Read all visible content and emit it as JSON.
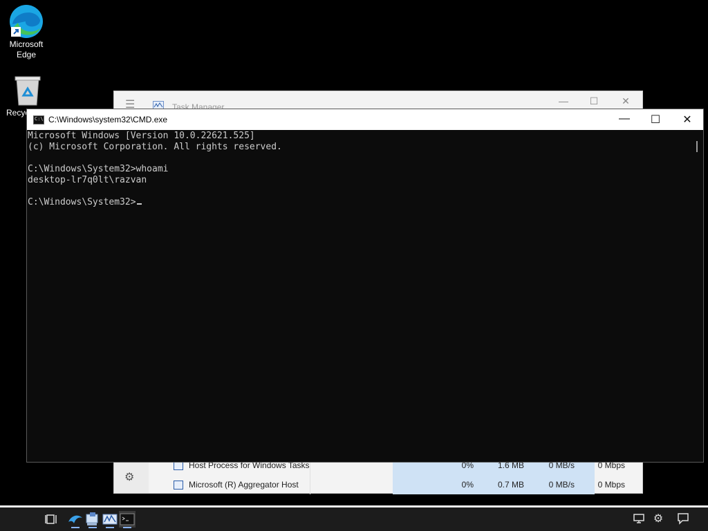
{
  "desktop": {
    "edge_label_line1": "Microsoft",
    "edge_label_line2": "Edge",
    "recycle_label": "Recycle Bin"
  },
  "task_manager": {
    "title": "Task Manager",
    "rows": [
      {
        "name": "Host Process for Windows Tasks",
        "cpu": "0%",
        "memory": "1.6 MB",
        "disk": "0 MB/s",
        "network": "0 Mbps"
      },
      {
        "name": "Microsoft (R) Aggregator Host",
        "cpu": "0%",
        "memory": "0.7 MB",
        "disk": "0 MB/s",
        "network": "0 Mbps"
      }
    ]
  },
  "cmd": {
    "title": "C:\\Windows\\system32\\CMD.exe",
    "lines": [
      "Microsoft Windows [Version 10.0.22621.525]",
      "(c) Microsoft Corporation. All rights reserved.",
      "",
      "C:\\Windows\\System32>whoami",
      "desktop-lr7q0lt\\razvan",
      "",
      "C:\\Windows\\System32>"
    ]
  },
  "taskbar": {
    "apps": [
      "task-view-icon",
      "edge-dolphin-icon",
      "control-panel-icon",
      "task-manager-icon",
      "cmd-icon"
    ],
    "tray": [
      "network-icon",
      "settings-icon",
      "notification-icon"
    ]
  }
}
